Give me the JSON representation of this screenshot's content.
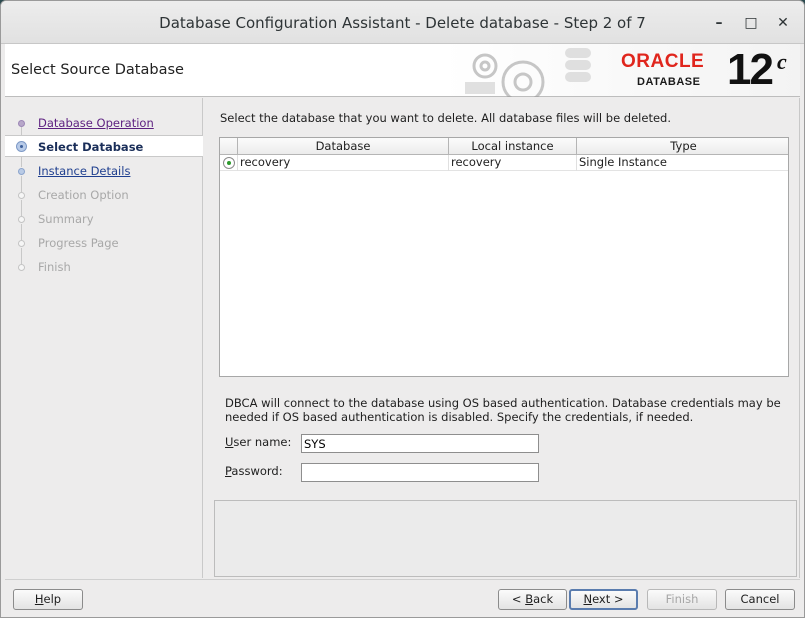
{
  "window": {
    "title": "Database Configuration Assistant - Delete database - Step 2 of 7",
    "minimize_glyph": "–",
    "maximize_glyph": "□",
    "close_glyph": "✕"
  },
  "header": {
    "page_title": "Select Source Database",
    "logo_brand": "ORACLE",
    "logo_product": "DATABASE",
    "logo_version": "12",
    "logo_version_suffix": "c"
  },
  "sidebar": {
    "steps": [
      {
        "label": "Database Operation",
        "state": "done"
      },
      {
        "label": "Select Database",
        "state": "active"
      },
      {
        "label": "Instance Details",
        "state": "link"
      },
      {
        "label": "Creation Option",
        "state": "disabled"
      },
      {
        "label": "Summary",
        "state": "disabled"
      },
      {
        "label": "Progress Page",
        "state": "disabled"
      },
      {
        "label": "Finish",
        "state": "disabled"
      }
    ]
  },
  "main": {
    "description": "Select the database that you want to delete. All database files will be deleted.",
    "table": {
      "columns": [
        "Database",
        "Local instance",
        "Type"
      ],
      "rows": [
        {
          "selected": true,
          "cells": [
            "recovery",
            "recovery",
            "Single Instance"
          ]
        }
      ]
    },
    "auth_text": "DBCA will connect to the database using OS based authentication. Database credentials may be needed if OS based authentication is disabled. Specify the credentials, if needed.",
    "username": {
      "label_mnemonic": "U",
      "label_rest": "ser name:",
      "value": "SYS"
    },
    "password": {
      "label_mnemonic": "P",
      "label_rest": "assword:",
      "value": ""
    }
  },
  "buttons": {
    "help_mnemonic": "H",
    "help_rest": "elp",
    "back_prefix": "< ",
    "back_mnemonic": "B",
    "back_rest": "ack",
    "next_mnemonic": "N",
    "next_rest": "ext >",
    "finish": "Finish",
    "cancel": "Cancel"
  },
  "colors": {
    "oracle_red": "#e0261d",
    "link_purple": "#5c1f80",
    "link_blue": "#1f3f8f",
    "active_step": "#1a2e59"
  }
}
